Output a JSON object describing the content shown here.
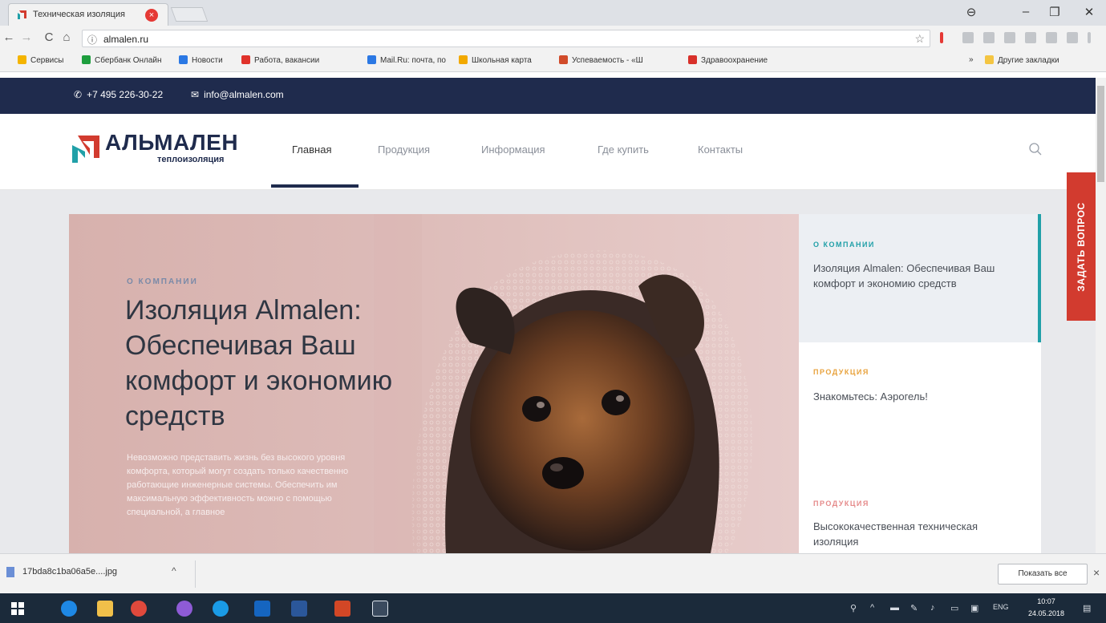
{
  "browser": {
    "tab_title": "Техническая изоляция",
    "tab_close": "×",
    "url": "almalen.ru",
    "info_icon": "ⓘ",
    "star_icon": "☆",
    "window_controls": [
      "⊖",
      "–",
      "❐",
      "✕"
    ],
    "nav": {
      "back": "←",
      "forward": "→",
      "reload": "C",
      "home": "⌂"
    }
  },
  "bookmarks": [
    {
      "label": "Сервисы",
      "color": "#f4b400"
    },
    {
      "label": "Сбербанк Онлайн",
      "color": "#1e9e3e"
    },
    {
      "label": "Новости",
      "color": "#2b78e4"
    },
    {
      "label": "Работа, вакансии",
      "color": "#e0322b"
    },
    {
      "label": "Mail.Ru: почта, по",
      "color": "#2b78e4"
    },
    {
      "label": "Школьная карта",
      "color": "#f2a900"
    },
    {
      "label": "Успеваемость - «Ш",
      "color": "#d14b2a"
    },
    {
      "label": "Здравоохранение",
      "color": "#d8302a"
    }
  ],
  "bookmarks_more": "»",
  "bookmarks_other": "Другие закладки",
  "site": {
    "phone": "+7 495 226-30-22",
    "email": "info@almalen.com",
    "logo_name": "АЛЬМАЛЕН",
    "logo_sub": "теплоизоляция",
    "menu": [
      "Главная",
      "Продукция",
      "Информация",
      "Где купить",
      "Контакты"
    ],
    "ask_button": "ЗАДАТЬ ВОПРОС",
    "hero": {
      "kicker": "О КОМПАНИИ",
      "title": "Изоляция Almalen: Обеспечивая Ваш комфорт и экономию средств",
      "text": "Невозможно представить жизнь без высокого уровня комфорта, который могут создать только качественно работающие инженерные системы. Обеспечить им максимальную эффективность можно с помощью специальной, а главное"
    },
    "side_cards": [
      {
        "kicker": "О КОМПАНИИ",
        "kicker_color": "#21a0a8",
        "text": "Изоляция Almalen: Обеспечивая Ваш комфорт и экономию средств"
      },
      {
        "kicker": "ПРОДУКЦИЯ",
        "kicker_color": "#e8a23c",
        "text": "Знакомьтесь: Аэрогель!"
      },
      {
        "kicker": "ПРОДУКЦИЯ",
        "kicker_color": "#e58a8a",
        "text": "Высококачественная техническая изоляция"
      }
    ]
  },
  "downloads": {
    "file": "17bda8c1ba06a5e....jpg",
    "chevron": "^",
    "show_all": "Показать все",
    "close": "×"
  },
  "taskbar": {
    "lang": "ENG",
    "time": "10:07",
    "date": "24.05.2018"
  },
  "colors": {
    "brand_navy": "#1f2b4d",
    "accent_teal": "#21a0a8",
    "ask_red": "#d23b2f"
  }
}
